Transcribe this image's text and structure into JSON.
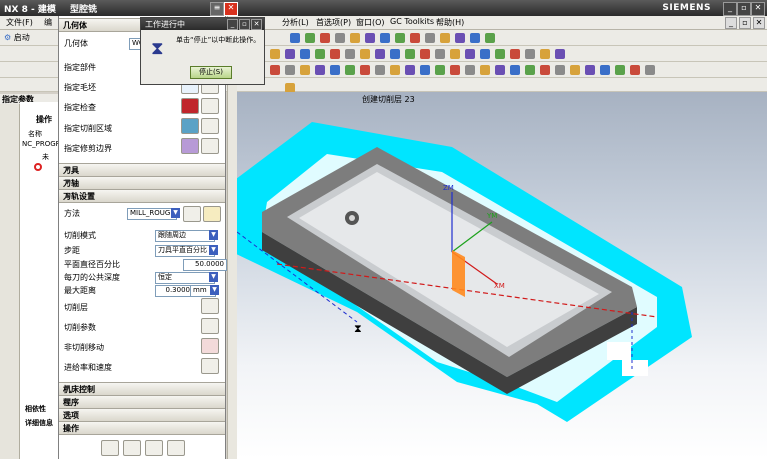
{
  "window": {
    "title": "NX 8 - 建模",
    "dialog_title": "型腔铣",
    "brand": "SIEMENS"
  },
  "menu": {
    "file": "文件(F)",
    "edit": "编",
    "analysis": "分析(L)",
    "preferences": "首选项(P)",
    "window": "窗口(O)",
    "gc_toolkits": "GC Toolkits",
    "help": "帮助(H)"
  },
  "left_toolbar": {
    "start_label": "启动",
    "panel_header": "指定参数",
    "nav_header": "操作",
    "col_name": "名称",
    "nc_program": "NC_PROGRA",
    "unused": "未",
    "related": "相依性",
    "details": "详细信息"
  },
  "dialog": {
    "geometry_header": "几何体",
    "geometry_label": "几何体",
    "geometry_value": "WOR",
    "specify_part": "指定部件",
    "specify_blank": "指定毛坯",
    "specify_check": "指定检查",
    "specify_cut_area": "指定切削区域",
    "specify_trim": "指定修剪边界",
    "tool_header": "刀具",
    "axis_header": "刀轴",
    "path_header": "刀轨设置",
    "method_label": "方法",
    "method_value": "MILL_ROUGH",
    "cut_mode_label": "切削模式",
    "cut_mode_value": "跟随周边",
    "stepover_label": "步距",
    "stepover_value": "刀具平直百分比",
    "flat_pct_label": "平面直径百分比",
    "flat_pct_value": "50.0000",
    "depth_per_cut_label": "每刀的公共深度",
    "depth_per_cut_value": "恒定",
    "max_dist_label": "最大距离",
    "max_dist_value": "0.3000",
    "max_dist_unit": "mm",
    "cut_levels": "切削层",
    "cut_params": "切削参数",
    "non_cut_moves": "非切削移动",
    "feeds_speeds": "进给率和速度",
    "machine_ctrl": "机床控制",
    "program": "程序",
    "options": "选项",
    "actions": "操作"
  },
  "popup": {
    "title": "工作进行中",
    "message": "单击“停止”以中断此操作。",
    "stop_button": "停止(S)"
  },
  "viewport": {
    "status_text": "创建切削层 23",
    "axis_xm": "XM",
    "axis_ym": "YM",
    "axis_zm": "ZM"
  },
  "colors": {
    "cyan_blank": "#00e5ff",
    "part_gray": "#5f5f5f",
    "axis_blue": "#1f2fcf",
    "axis_green": "#1ca21c",
    "axis_red": "#d11a1a",
    "orange_tool": "#ff8a1e"
  }
}
